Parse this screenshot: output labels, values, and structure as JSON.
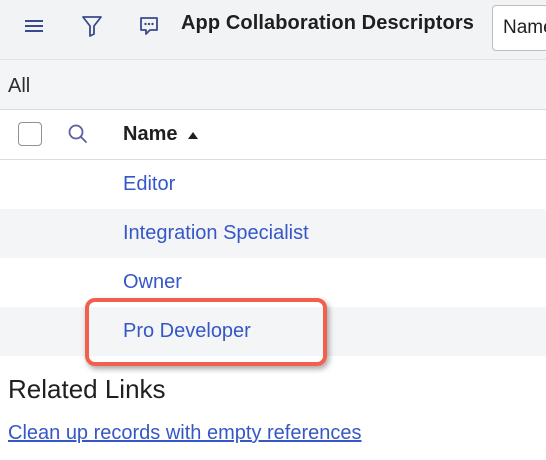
{
  "header": {
    "title": "App Collaboration Descriptors",
    "search_field_value": "Name",
    "icons": [
      "menu-icon",
      "filter-icon",
      "chat-icon"
    ]
  },
  "breadcrumb": {
    "label": "All"
  },
  "list": {
    "columns": [
      {
        "label": "Name",
        "sort": "ascending"
      }
    ],
    "rows": [
      {
        "name": "Editor"
      },
      {
        "name": "Integration Specialist"
      },
      {
        "name": "Owner"
      },
      {
        "name": "Pro Developer"
      }
    ],
    "highlighted_row": "Pro Developer"
  },
  "related_links": {
    "title": "Related Links",
    "links": [
      "Clean up records with empty references"
    ]
  },
  "colors": {
    "link": "#3557c7",
    "highlight": "#f25f4c",
    "header_bg": "#f1f3f5"
  }
}
